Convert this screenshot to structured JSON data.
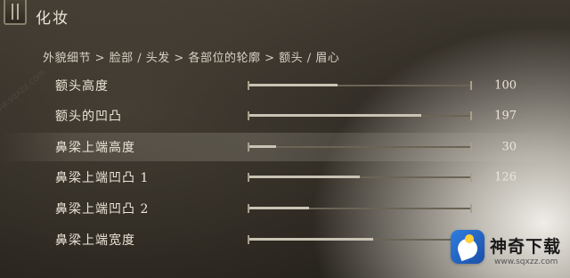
{
  "header": {
    "title": "化妆",
    "menu_icon": "menu-book-icon"
  },
  "breadcrumb": "外貌细节 > 脸部 / 头发 > 各部位的轮廓 > 额头 / 眉心",
  "rows": [
    {
      "label": "额头高度",
      "value": "100",
      "fill": 0.4,
      "selected": false
    },
    {
      "label": "额头的凹凸",
      "value": "197",
      "fill": 0.78,
      "selected": false
    },
    {
      "label": "鼻梁上端高度",
      "value": "30",
      "fill": 0.12,
      "selected": true
    },
    {
      "label": "鼻梁上端凹凸 1",
      "value": "126",
      "fill": 0.5,
      "selected": false
    },
    {
      "label": "鼻梁上端凹凸 2",
      "value": "",
      "fill": 0.27,
      "selected": false
    },
    {
      "label": "鼻梁上端宽度",
      "value": "",
      "fill": 0.56,
      "selected": false
    }
  ],
  "watermark": {
    "name": "神奇下载",
    "url": "www.sqxzz.com",
    "diagonal": "www.sqxzz.com"
  },
  "colors": {
    "track": "#6b6455",
    "fill": "#c9c3b4",
    "text": "#ece6d8",
    "logo_blue": "#2f7de0"
  }
}
